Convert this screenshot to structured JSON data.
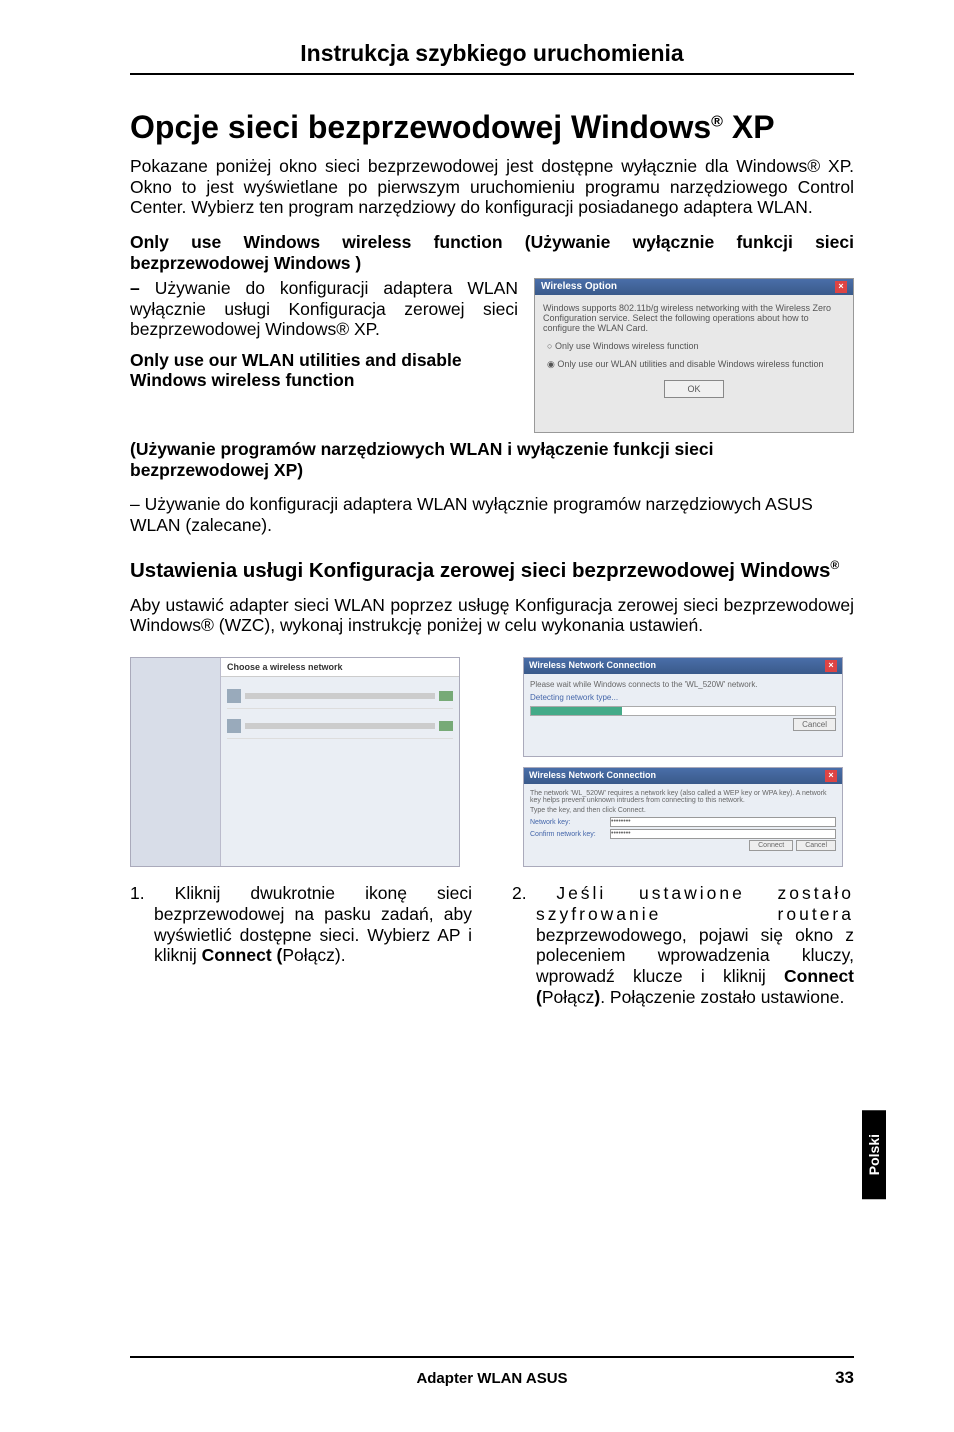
{
  "header": {
    "title": "Instrukcja szybkiego uruchomienia"
  },
  "h1": {
    "prefix": "Opcje sieci bezprzewodowej Windows",
    "reg": "®",
    "suffix": " XP"
  },
  "intro": "Pokazane poniżej okno sieci bezprzewodowej jest dostępne wyłącznie dla Windows® XP. Okno to jest wyświetlane po pierwszym uruchomieniu programu narzędziowego Control Center. Wybierz ten program narzędziowy do konfiguracji posiadanego adaptera WLAN.",
  "opt1_title": "Only use Windows wireless function  (Używanie wyłącznie funkcji sieci bezprzewodowej Windows )",
  "opt1_body_prefix": "– ",
  "opt1_body": "Używanie do konfiguracji adaptera WLAN wyłącznie usługi Konfiguracja zerowej sieci bezprzewodowej Windows® XP.",
  "opt2_title_a": "Only use our WLAN utilities and disable Windows wireless function",
  "opt2_title_b": "(Używanie programów narzędziowych WLAN i wyłączenie funkcji sieci bezprzewodowej XP)",
  "opt2_body": "– Używanie do konfiguracji adaptera WLAN wyłącznie programów narzędziowych ASUS WLAN (zalecane).",
  "h2": {
    "line": "Ustawienia usługi Konfiguracja zerowej sieci bezprzewodowej Windows",
    "reg": "®"
  },
  "h2_body": "Aby ustawić adapter sieci WLAN poprzez usługę Konfiguracja zerowej sieci bezprzewodowej Windows® (WZC), wykonaj instrukcję poniżej w celu wykonania ustawień.",
  "dialog": {
    "title": "Wireless Option",
    "desc": "Windows supports 802.11b/g wireless networking with the Wireless Zero Configuration service. Select the following operations about how to configure the WLAN Card.",
    "radio1": "Only use Windows wireless function",
    "radio2": "Only use our WLAN utilities and disable Windows wireless function",
    "ok": "OK"
  },
  "shot_left": {
    "title": "Choose a wireless network"
  },
  "shot_right_top": {
    "title": "Wireless Network Connection",
    "body": "Please wait while Windows connects to the 'WL_520W' network.",
    "sub": "Detecting network type...",
    "btn": "Cancel"
  },
  "shot_right_bottom": {
    "title": "Wireless Network Connection",
    "body": "The network 'WL_520W' requires a network key (also called a WEP key or WPA key). A network key helps prevent unknown intruders from connecting to this network.",
    "line": "Type the key, and then click Connect.",
    "f1": "Network key:",
    "f2": "Confirm network key:",
    "btn1": "Connect",
    "btn2": "Cancel"
  },
  "step1": {
    "num": "1. ",
    "text_a": "Kliknij dwukrotnie ikonę sieci bezprzewodowej na pasku zadań, aby wyświetlić dostępne sieci. Wybierz AP i kliknij ",
    "bold": "Connect (",
    "text_b": "Połącz)."
  },
  "step2": {
    "num": "2. ",
    "text_a_wide": "Jeśli ustawione zostało szyfrowanie routera ",
    "text_a": "bezprzewodowego, pojawi się okno z poleceniem wprowadzenia kluczy, wprowadź klucze i kliknij ",
    "bold": "Connect (",
    "mid": "Połącz",
    "bold2": ")",
    "text_b": ". Połączenie zostało ustawione."
  },
  "sidetab": "Polski",
  "footer": {
    "center": "Adapter WLAN ASUS",
    "page": "33"
  }
}
